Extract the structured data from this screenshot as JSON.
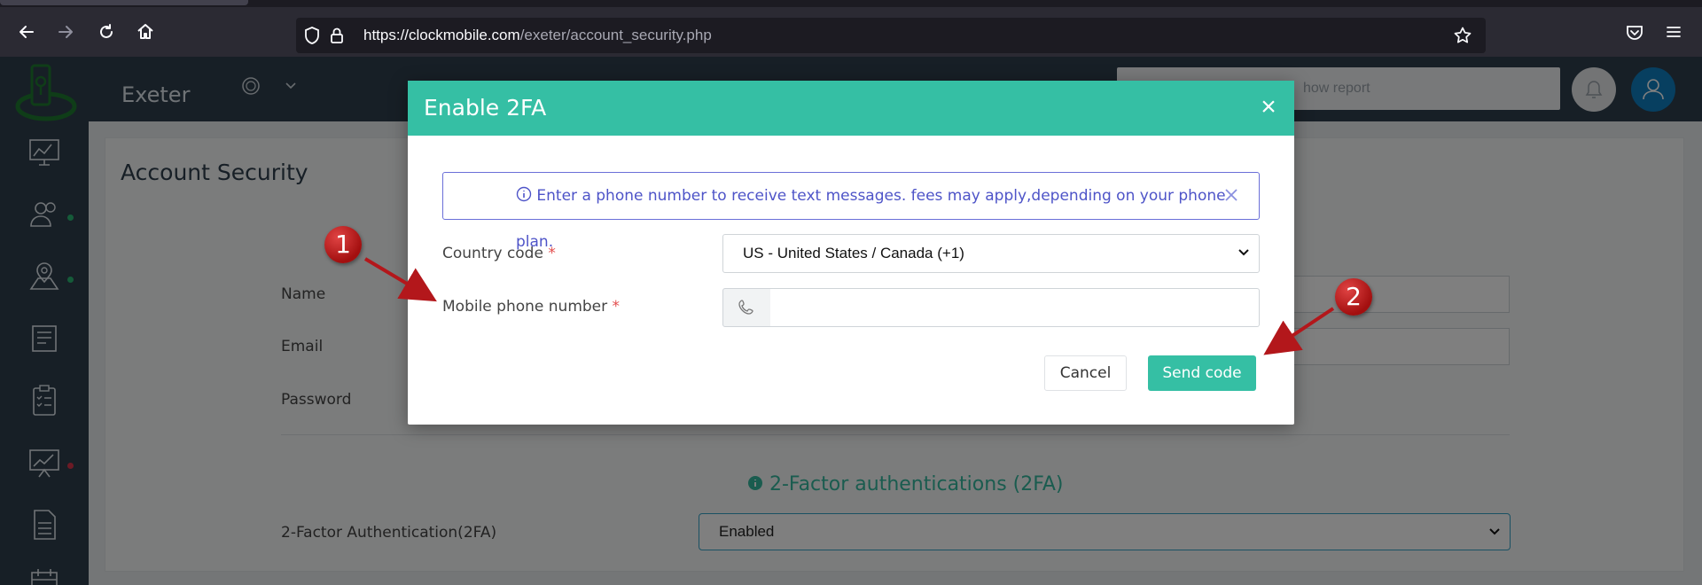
{
  "browser": {
    "url_host": "https://clockmobile.com",
    "url_path": "/exeter/account_security.php"
  },
  "app": {
    "brand": "Exeter",
    "search_placeholder": "how report",
    "sidebar_dots": [
      "#2bb673",
      "#2bb673",
      "#d9344b"
    ]
  },
  "page": {
    "title": "Account Security",
    "fields": {
      "name_label": "Name",
      "email_label": "Email",
      "password_label": "Password"
    },
    "twofa_heading": "2-Factor authentications (2FA)",
    "twofa_label": "2-Factor Authentication(2FA)",
    "twofa_value": "Enabled"
  },
  "modal": {
    "title": "Enable 2FA",
    "close_glyph": "×",
    "alert_text": "Enter a phone number to receive text messages. fees may apply,depending on your phone plan.",
    "country_label": "Country code",
    "country_value": "US - United States / Canada (+1)",
    "phone_label": "Mobile phone number",
    "phone_value": "",
    "required_mark": "*",
    "cancel_label": "Cancel",
    "send_label": "Send code"
  },
  "annotations": {
    "step1": "1",
    "step2": "2",
    "color": "#b3171b"
  }
}
